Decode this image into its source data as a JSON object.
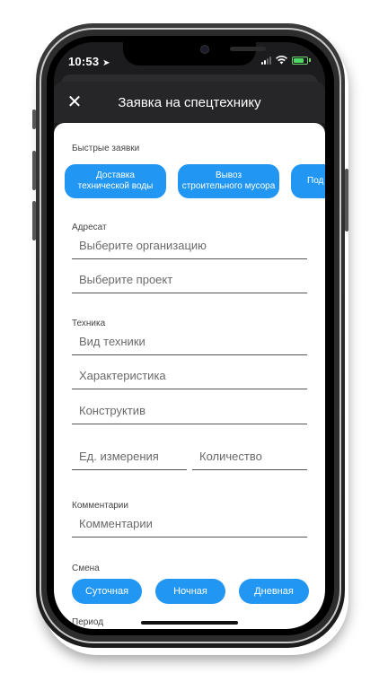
{
  "status": {
    "time": "10:53"
  },
  "header": {
    "title": "Заявка на спецтехнику",
    "close_icon": "close-icon"
  },
  "quick": {
    "label": "Быстрые заявки",
    "chips": [
      {
        "label": "Доставка\nтехнической воды"
      },
      {
        "label": "Вывоз\nстроительного мусора"
      },
      {
        "label": "Под"
      }
    ]
  },
  "addressee": {
    "label": "Адресат",
    "org_placeholder": "Выберите организацию",
    "project_placeholder": "Выберите проект"
  },
  "equipment": {
    "label": "Техника",
    "type_placeholder": "Вид техники",
    "spec_placeholder": "Характеристика",
    "design_placeholder": "Конструктив",
    "unit_placeholder": "Ед. измерения",
    "qty_placeholder": "Количество"
  },
  "comment": {
    "label": "Комментарии",
    "placeholder": "Комментарии"
  },
  "shift": {
    "label": "Смена",
    "options": [
      {
        "label": "Суточная"
      },
      {
        "label": "Ночная"
      },
      {
        "label": "Дневная"
      }
    ]
  },
  "period": {
    "label": "Период"
  },
  "colors": {
    "accent": "#2196f3",
    "header_bg": "#262628"
  }
}
